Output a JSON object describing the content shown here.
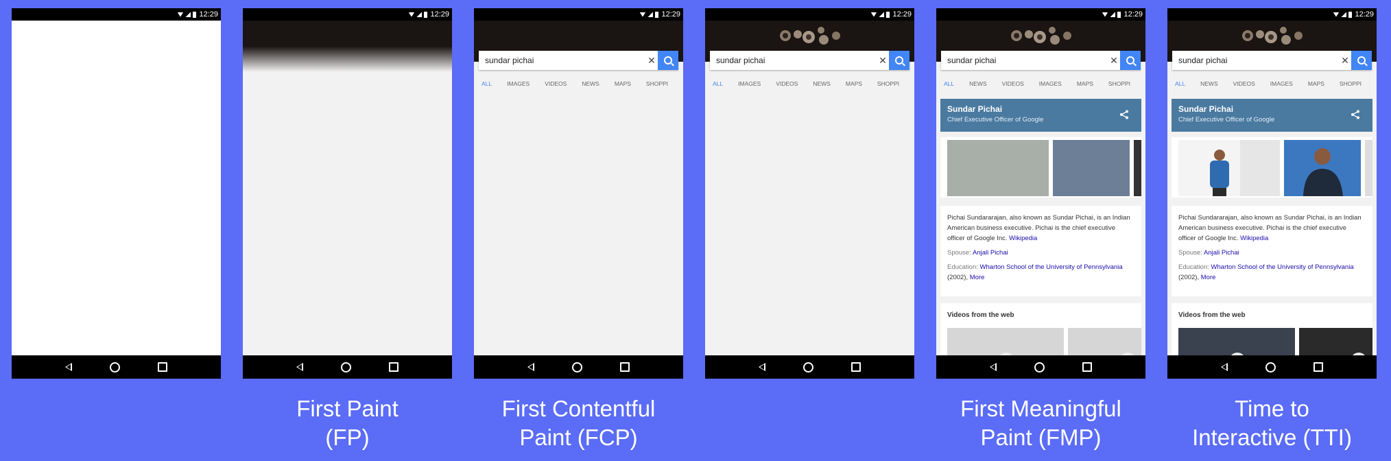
{
  "colors": {
    "background": "#5b6cf7",
    "accent": "#4285f4",
    "kp_header": "#4a7aa0"
  },
  "status_time": "12:29",
  "search": {
    "query": "sundar pichai",
    "clear": "✕"
  },
  "tabs_a": [
    "ALL",
    "IMAGES",
    "VIDEOS",
    "NEWS",
    "MAPS",
    "SHOPPI"
  ],
  "tabs_b": [
    "ALL",
    "NEWS",
    "VIDEOS",
    "IMAGES",
    "MAPS",
    "SHOPPI"
  ],
  "knowledge_panel": {
    "name": "Sundar Pichai",
    "title": "Chief Executive Officer of Google",
    "desc_1": "Pichai Sundararajan, also known as Sundar Pichai, is an Indian American business executive. Pichai is the chief executive officer of Google Inc. ",
    "desc_link": "Wikipedia",
    "spouse_label": "Spouse: ",
    "spouse_value": "Anjali Pichai",
    "education_label": "Education: ",
    "education_value": "Wharton School of the University of Pennsylvania",
    "education_year": " (2002), ",
    "education_more": "More",
    "videos_title": "Videos from the web"
  },
  "captions": {
    "fp_line1": "First Paint",
    "fp_line2": "(FP)",
    "fcp_line1": "First Contentful",
    "fcp_line2": "Paint (FCP)",
    "fmp_line1": "First Meaningful",
    "fmp_line2": "Paint (FMP)",
    "tti_line1": "Time to",
    "tti_line2": "Interactive (TTI)"
  }
}
